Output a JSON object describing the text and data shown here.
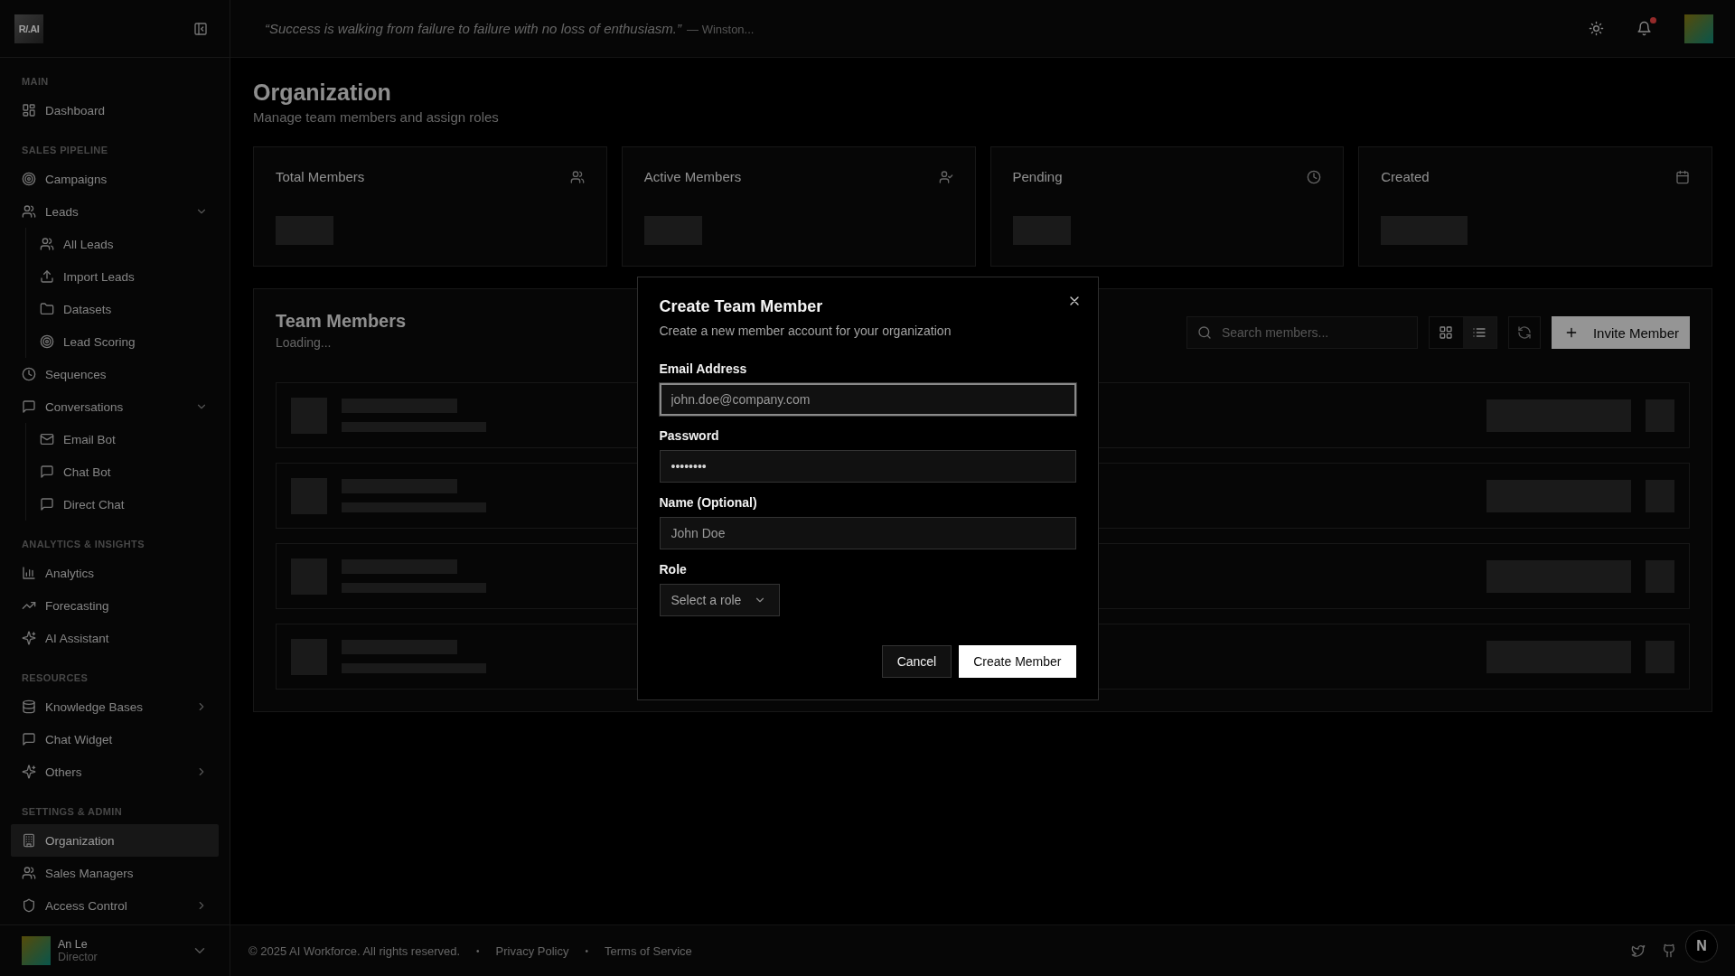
{
  "sidebar": {
    "logo": "R/.AI",
    "sections": [
      {
        "title": "MAIN",
        "items": [
          {
            "label": "Dashboard",
            "selected": false
          }
        ]
      },
      {
        "title": "SALES PIPELINE",
        "items": [
          {
            "label": "Campaigns",
            "selected": false
          },
          {
            "label": "Leads",
            "selected": false,
            "expanded": true,
            "children": [
              {
                "label": "All Leads",
                "selected": false
              },
              {
                "label": "Import Leads",
                "selected": false
              },
              {
                "label": "Datasets",
                "selected": false
              },
              {
                "label": "Lead Scoring",
                "selected": false
              }
            ]
          },
          {
            "label": "Sequences",
            "selected": false
          },
          {
            "label": "Conversations",
            "selected": false,
            "expanded": true,
            "children": [
              {
                "label": "Email Bot",
                "selected": false
              },
              {
                "label": "Chat Bot",
                "selected": false
              },
              {
                "label": "Direct Chat",
                "selected": false
              }
            ]
          }
        ]
      },
      {
        "title": "ANALYTICS & INSIGHTS",
        "items": [
          {
            "label": "Analytics",
            "selected": false
          },
          {
            "label": "Forecasting",
            "selected": false
          },
          {
            "label": "AI Assistant",
            "selected": false
          }
        ]
      },
      {
        "title": "RESOURCES",
        "items": [
          {
            "label": "Knowledge Bases",
            "selected": false,
            "expanded": false
          },
          {
            "label": "Chat Widget",
            "selected": false
          },
          {
            "label": "Others",
            "selected": false,
            "expanded": false
          }
        ]
      },
      {
        "title": "SETTINGS & ADMIN",
        "items": [
          {
            "label": "Organization",
            "selected": true
          },
          {
            "label": "Sales Managers",
            "selected": false
          },
          {
            "label": "Access Control",
            "selected": false,
            "expanded": false
          }
        ]
      }
    ],
    "user": {
      "name": "An Le",
      "role": "Director"
    }
  },
  "topbar": {
    "quote": "“Success is walking from failure to failure with no loss of enthusiasm.”",
    "author": "— Winston...",
    "has_notifications": true
  },
  "page": {
    "title": "Organization",
    "subtitle": "Manage team members and assign roles"
  },
  "stats": [
    {
      "title": "Total Members"
    },
    {
      "title": "Active Members"
    },
    {
      "title": "Pending"
    },
    {
      "title": "Created"
    }
  ],
  "team": {
    "title": "Team Members",
    "status": "Loading...",
    "search": {
      "placeholder": "Search members..."
    },
    "views": [
      {
        "kind": "grid",
        "selected": false
      },
      {
        "kind": "list",
        "selected": true
      }
    ],
    "invite_button": "Invite Member"
  },
  "modal": {
    "title": "Create Team Member",
    "description": "Create a new member account for your organization",
    "fields": [
      {
        "label": "Email Address",
        "placeholder": "john.doe@company.com",
        "focused": true
      },
      {
        "label": "Password",
        "value": "••••••••",
        "focused": false
      },
      {
        "label": "Name (Optional)",
        "placeholder": "John Doe",
        "focused": false
      }
    ],
    "role": {
      "label": "Role",
      "placeholder": "Select a role"
    },
    "cancel_button": "Cancel",
    "submit_button": "Create Member"
  },
  "footer": {
    "items": [
      {
        "kind": "text",
        "text": "© 2025 AI Workforce. All rights reserved."
      },
      {
        "kind": "sep",
        "text": "•"
      },
      {
        "kind": "link",
        "text": "Privacy Policy"
      },
      {
        "kind": "sep",
        "text": "•"
      },
      {
        "kind": "link",
        "text": "Terms of Service"
      }
    ],
    "dev_badge": "N"
  }
}
